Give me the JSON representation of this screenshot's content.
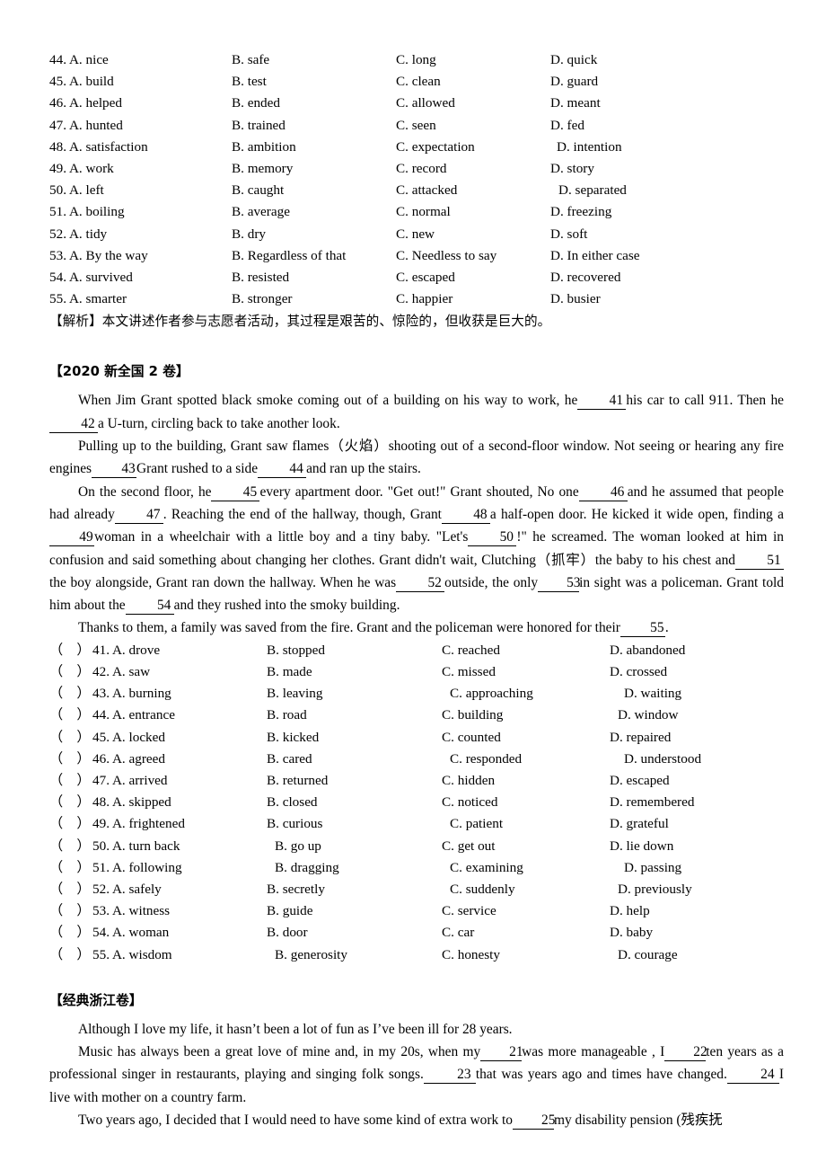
{
  "document": {
    "title": "English Cloze Test Worksheet Page"
  },
  "block1": {
    "name": "options-44-55",
    "rows": [
      {
        "num": "44.",
        "a": "A. nice",
        "b": "B. safe",
        "c": "C. long",
        "d": "D. quick"
      },
      {
        "num": "45.",
        "a": "A. build",
        "b": "B. test",
        "c": "C. clean",
        "d": "D. guard"
      },
      {
        "num": "46.",
        "a": "A. helped",
        "b": "B. ended",
        "c": "C. allowed",
        "d": "D. meant"
      },
      {
        "num": "47.",
        "a": "A. hunted",
        "b": "B. trained",
        "c": "C. seen",
        "d": "D. fed"
      },
      {
        "num": "48.",
        "a": "A. satisfaction",
        "b": "B. ambition",
        "c": "C. expectation",
        "d": "D. intention"
      },
      {
        "num": "49.",
        "a": "A. work",
        "b": "B. memory",
        "c": "C. record",
        "d": "D. story"
      },
      {
        "num": "50.",
        "a": "A. left",
        "b": "B. caught",
        "c": "C. attacked",
        "d": "D. separated"
      },
      {
        "num": "51.",
        "a": "A. boiling",
        "b": "B. average",
        "c": "C. normal",
        "d": "D. freezing"
      },
      {
        "num": "52.",
        "a": "A. tidy",
        "b": "B. dry",
        "c": "C. new",
        "d": "D. soft"
      },
      {
        "num": "53.",
        "a": "A. By the way",
        "b": "B. Regardless of that",
        "c": "C. Needless to say",
        "d": "D. In either case"
      },
      {
        "num": "54.",
        "a": "A. survived",
        "b": "B. resisted",
        "c": "C. escaped",
        "d": "D. recovered"
      },
      {
        "num": "55.",
        "a": "A. smarter",
        "b": "B. stronger",
        "c": "C. happier",
        "d": "D. busier"
      }
    ],
    "analysis": "【解析】本文讲述作者参与志愿者活动，其过程是艰苦的、惊险的，但收获是巨大的。"
  },
  "section2": {
    "heading": "【2020 新全国 2 卷】",
    "paragraphs": [
      {
        "id": "p1",
        "parts": [
          {
            "t": "text",
            "v": "When Jim Grant spotted black smoke coming out of a building on his way to work, he"
          },
          {
            "t": "blank",
            "v": "41"
          },
          {
            "t": "text",
            "v": "his car to call 911. Then he"
          },
          {
            "t": "blank",
            "v": "42"
          },
          {
            "t": "text",
            "v": "a U-turn, circling back to take another look."
          }
        ]
      },
      {
        "id": "p2",
        "parts": [
          {
            "t": "text",
            "v": "Pulling up to the building, Grant saw flames（火焰）shooting out of a second-floor window. Not seeing or hearing any fire engines"
          },
          {
            "t": "blank",
            "v": "43"
          },
          {
            "t": "text",
            "v": "Grant rushed to a side"
          },
          {
            "t": "blank",
            "v": "44"
          },
          {
            "t": "text",
            "v": "and ran up the stairs."
          }
        ]
      },
      {
        "id": "p3",
        "parts": [
          {
            "t": "text",
            "v": "On the second floor, he"
          },
          {
            "t": "blank",
            "v": "45"
          },
          {
            "t": "text",
            "v": "every apartment door. \"Get out!\" Grant shouted, No one"
          },
          {
            "t": "blank",
            "v": "46"
          },
          {
            "t": "text",
            "v": "and he assumed that people had already"
          },
          {
            "t": "blank",
            "v": "47"
          },
          {
            "t": "text",
            "v": ". Reaching the end of the hallway, though, Grant"
          },
          {
            "t": "blank",
            "v": "48"
          },
          {
            "t": "text",
            "v": "a half-open door. He kicked it wide open, finding a"
          },
          {
            "t": "blank",
            "v": "49"
          },
          {
            "t": "text",
            "v": "woman in a wheelchair with a little boy and a tiny baby. \"Let's"
          },
          {
            "t": "blank",
            "v": "50"
          },
          {
            "t": "text",
            "v": "!\" he screamed. The woman looked at him in confusion and said something about changing her clothes. Grant didn't wait, Clutching（抓牢）the baby to his chest and"
          },
          {
            "t": "blank",
            "v": "51"
          },
          {
            "t": "text",
            "v": "the boy alongside, Grant ran down the hallway. When he was"
          },
          {
            "t": "blank",
            "v": "52"
          },
          {
            "t": "text",
            "v": "outside, the only"
          },
          {
            "t": "blank",
            "v": "53"
          },
          {
            "t": "text",
            "v": "in sight was a policeman. Grant told him about the"
          },
          {
            "t": "blank",
            "v": "54"
          },
          {
            "t": "text",
            "v": "and they rushed into the smoky building."
          }
        ]
      },
      {
        "id": "p4",
        "parts": [
          {
            "t": "text",
            "v": "Thanks to them, a family was saved from the fire. Grant and the policeman were honored for their"
          },
          {
            "t": "blank",
            "v": "55"
          },
          {
            "t": "text",
            "v": "."
          }
        ]
      }
    ],
    "options": {
      "paren_open": "（",
      "paren_close": "）",
      "rows": [
        {
          "num": "41.",
          "a": "A. drove",
          "b": "B. stopped",
          "c": "C. reached",
          "d": "D. abandoned"
        },
        {
          "num": "42.",
          "a": "A. saw",
          "b": "B. made",
          "c": "C. missed",
          "d": "D. crossed"
        },
        {
          "num": "43.",
          "a": "A. burning",
          "b": "B. leaving",
          "c": "C. approaching",
          "d": "D. waiting"
        },
        {
          "num": "44.",
          "a": "A. entrance",
          "b": "B. road",
          "c": "C. building",
          "d": "D. window"
        },
        {
          "num": "45.",
          "a": "A. locked",
          "b": "B. kicked",
          "c": "C. counted",
          "d": "D. repaired"
        },
        {
          "num": "46.",
          "a": "A. agreed",
          "b": "B. cared",
          "c": "C. responded",
          "d": "D. understood"
        },
        {
          "num": "47.",
          "a": "A. arrived",
          "b": "B. returned",
          "c": "C. hidden",
          "d": "D. escaped"
        },
        {
          "num": "48.",
          "a": "A. skipped",
          "b": "B. closed",
          "c": "C. noticed",
          "d": "D. remembered"
        },
        {
          "num": "49.",
          "a": "A. frightened",
          "b": "B. curious",
          "c": "C. patient",
          "d": "D. grateful"
        },
        {
          "num": "50.",
          "a": "A. turn back",
          "b": "B. go up",
          "c": "C. get out",
          "d": "D. lie down"
        },
        {
          "num": "51.",
          "a": "A. following",
          "b": "B. dragging",
          "c": "C. examining",
          "d": "D. passing"
        },
        {
          "num": "52.",
          "a": "A. safely",
          "b": "B. secretly",
          "c": "C. suddenly",
          "d": "D. previously"
        },
        {
          "num": "53.",
          "a": "A. witness",
          "b": "B. guide",
          "c": "C. service",
          "d": "D. help"
        },
        {
          "num": "54.",
          "a": "A. woman",
          "b": "B. door",
          "c": "C. car",
          "d": "D. baby"
        },
        {
          "num": "55.",
          "a": "A. wisdom",
          "b": "B. generosity",
          "c": "C. honesty",
          "d": "D. courage"
        }
      ]
    }
  },
  "section3": {
    "heading": "【经典浙江卷】",
    "paragraphs": [
      {
        "id": "q1",
        "parts": [
          {
            "t": "text",
            "v": "Although I love my life, it hasn’t been a lot of fun as I’ve been ill for 28 years."
          }
        ]
      },
      {
        "id": "q2",
        "parts": [
          {
            "t": "text",
            "v": "Music has always been a great love of mine and, in my 20s, when my"
          },
          {
            "t": "blank",
            "v": "21"
          },
          {
            "t": "text",
            "v": "was more manageable , I"
          },
          {
            "t": "blank",
            "v": "22"
          },
          {
            "t": "text",
            "v": "ten years as a professional singer in restaurants, playing and singing folk songs."
          },
          {
            "t": "blank",
            "v": "23"
          },
          {
            "t": "text",
            "v": "that was years ago and times have changed."
          },
          {
            "t": "blank",
            "v": "24"
          },
          {
            "t": "text",
            "v": "I live with mother on a country farm."
          }
        ]
      },
      {
        "id": "q3",
        "parts": [
          {
            "t": "text",
            "v": "Two years ago, I decided that I would need to have some kind of extra work to"
          },
          {
            "t": "blank",
            "v": "25"
          },
          {
            "t": "text",
            "v": "my disability pension (残疾抚"
          }
        ]
      }
    ]
  }
}
